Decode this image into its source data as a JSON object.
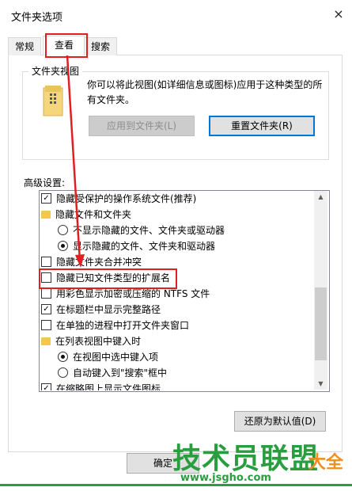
{
  "window": {
    "title": "文件夹选项",
    "close": "×"
  },
  "tabs": [
    {
      "label": "常规"
    },
    {
      "label": "查看"
    },
    {
      "label": "搜索"
    }
  ],
  "folder_views": {
    "title": "文件夹视图",
    "description": "你可以将此视图(如详细信息或图标)应用于这种类型的所有文件夹。",
    "apply_button": "应用到文件夹(L)",
    "reset_button": "重置文件夹(R)"
  },
  "advanced_label": "高级设置:",
  "advanced_items": [
    {
      "type": "checkbox",
      "checked": true,
      "label": "隐藏受保护的操作系统文件(推荐)"
    },
    {
      "type": "folder",
      "label": "隐藏文件和文件夹"
    },
    {
      "type": "radio",
      "checked": false,
      "label": "不显示隐藏的文件、文件夹或驱动器"
    },
    {
      "type": "radio",
      "checked": true,
      "label": "显示隐藏的文件、文件夹和驱动器"
    },
    {
      "type": "checkbox",
      "checked": false,
      "label": "隐藏文件夹合并冲突"
    },
    {
      "type": "checkbox",
      "checked": false,
      "label": "隐藏已知文件类型的扩展名"
    },
    {
      "type": "checkbox",
      "checked": false,
      "label": "用彩色显示加密或压缩的 NTFS 文件"
    },
    {
      "type": "checkbox",
      "checked": true,
      "label": "在标题栏中显示完整路径"
    },
    {
      "type": "checkbox",
      "checked": false,
      "label": "在单独的进程中打开文件夹窗口"
    },
    {
      "type": "folder",
      "label": "在列表视图中键入时"
    },
    {
      "type": "radio",
      "checked": true,
      "label": "在视图中选中键入项"
    },
    {
      "type": "radio",
      "checked": false,
      "label": "自动键入到\"搜索\"框中"
    },
    {
      "type": "checkbox",
      "checked": true,
      "label": "在缩略图上显示文件图标"
    }
  ],
  "restore_button": "还原为默认值(D)",
  "ok_button": "确定",
  "watermark": {
    "main": "技术员联盟",
    "url": "www.jsgho.com",
    "right": "大全"
  },
  "colors": {
    "highlight": "#e02020",
    "accent": "#0078d7",
    "watermark": "#2a9d3f"
  }
}
